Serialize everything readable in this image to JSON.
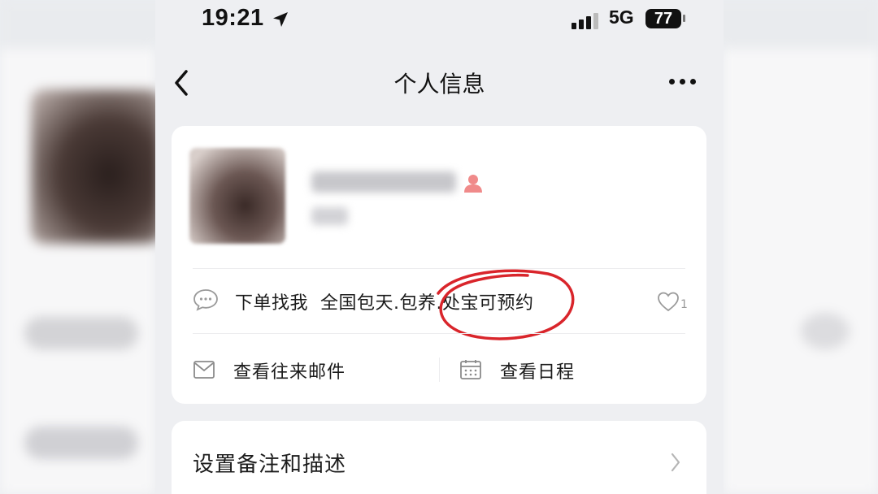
{
  "status_bar": {
    "time": "19:21",
    "network": "5G",
    "battery": "77"
  },
  "nav": {
    "title": "个人信息"
  },
  "profile": {
    "signature": "下单找我  全国包天.包养.处宝可预约",
    "likes": "1"
  },
  "actions": {
    "mail_label": "查看往来邮件",
    "calendar_label": "查看日程"
  },
  "settings": {
    "remark_label": "设置备注和描述"
  },
  "colors": {
    "annotation": "#d9252b",
    "gender_icon": "#f08a8a"
  }
}
